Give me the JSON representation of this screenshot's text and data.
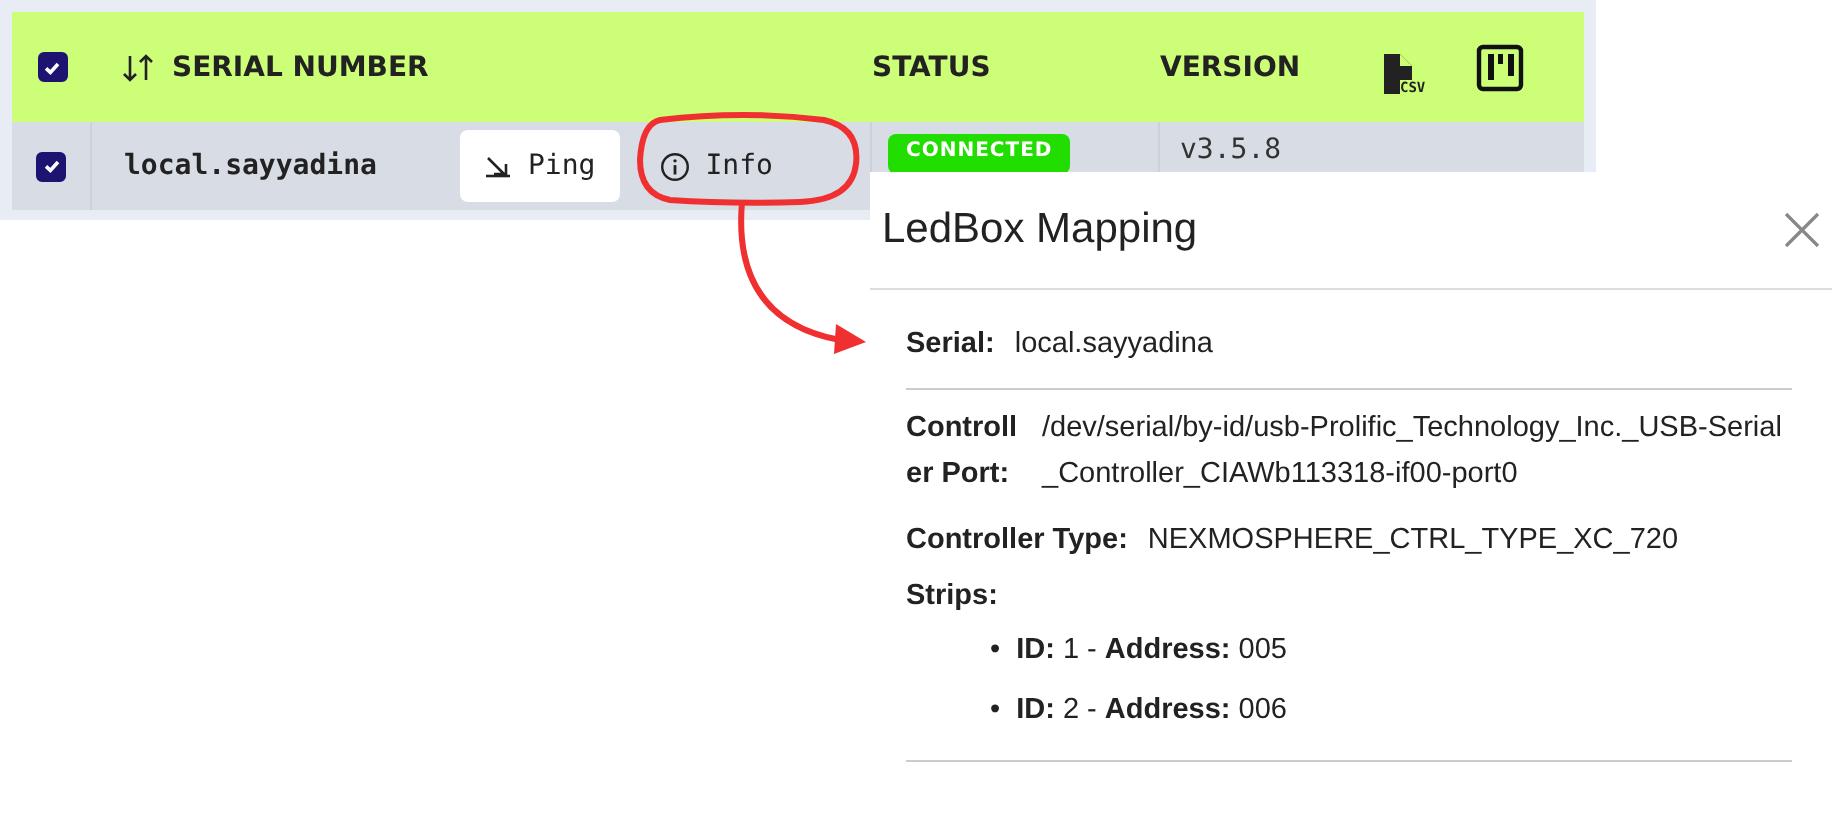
{
  "table": {
    "select_all": {
      "checked": true
    },
    "columns": [
      {
        "label": "SERIAL NUMBER",
        "sortable": true
      },
      {
        "label": "STATUS",
        "sortable": false
      },
      {
        "label": "VERSION",
        "sortable": false
      }
    ],
    "export_label": "CSV",
    "rows": [
      {
        "selected": true,
        "serial": "local.sayyadina",
        "actions": [
          {
            "kind": "ping",
            "label": "Ping"
          },
          {
            "kind": "info",
            "label": "Info"
          }
        ],
        "status": "CONNECTED",
        "version": "v3.5.8"
      }
    ]
  },
  "modal": {
    "title": "LedBox Mapping",
    "serial": {
      "label": "Serial:",
      "value": "local.sayyadina"
    },
    "fields": [
      {
        "label": "Controller Port:",
        "value": "/dev/serial/by-id/usb-Prolific_Technology_Inc._USB-Serial_Controller_CIAWb113318-if00-port0"
      },
      {
        "label": "Controller Type:",
        "value": "NEXMOSPHERE_CTRL_TYPE_XC_720"
      }
    ],
    "strips_label": "Strips:",
    "strips": [
      {
        "marker": "•",
        "text": "**ID:** 1 - **Address:** 005"
      },
      {
        "marker": "•",
        "text": "**ID:** 2 - **Address:** 006"
      }
    ]
  }
}
